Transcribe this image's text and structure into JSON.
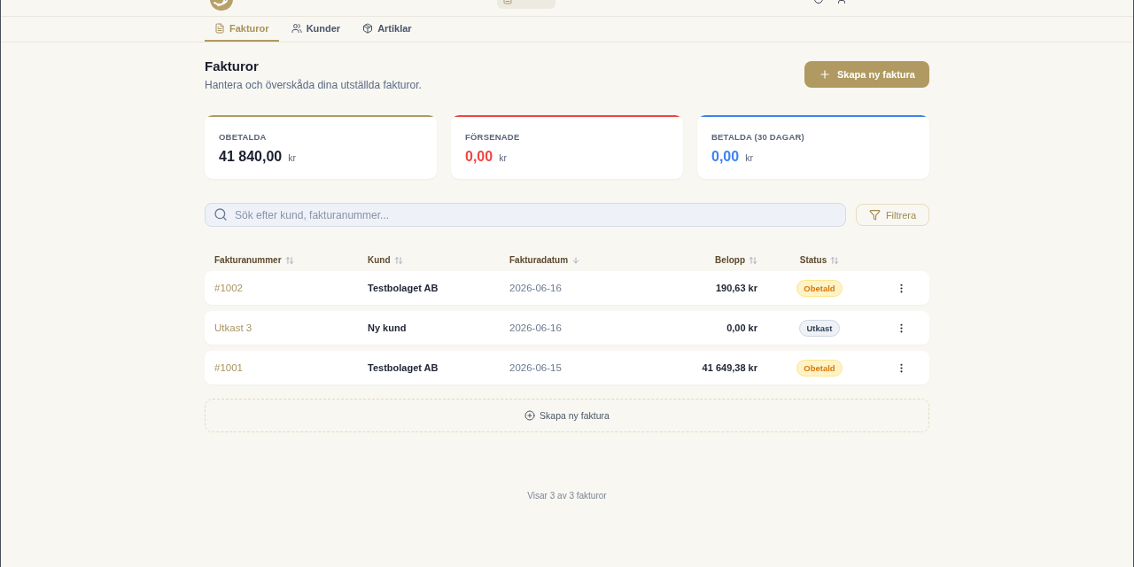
{
  "top_bar": {
    "nav": [
      {
        "selected": true
      }
    ]
  },
  "tabs": [
    {
      "label": "Fakturor",
      "kind": "document",
      "selected": true
    },
    {
      "label": "Kunder",
      "kind": "people",
      "selected": false
    },
    {
      "label": "Artiklar",
      "kind": "box",
      "selected": false
    }
  ],
  "header": {
    "title": "Fakturor",
    "subtitle": "Hantera och överskåda dina utställda fakturor.",
    "create_button": "Skapa ny faktura"
  },
  "summary_cards": [
    {
      "label": "OBETALDA",
      "amount": "41 840,00",
      "currency": "kr",
      "kind": "neutral",
      "color": "#b09a62"
    },
    {
      "label": "FÖRSENADE",
      "amount": "0,00",
      "currency": "kr",
      "kind": "accent",
      "color": "#ef4444"
    },
    {
      "label": "BETALDA (30 DAGAR)",
      "amount": "0,00",
      "currency": "kr",
      "kind": "accent",
      "color": "#3b82f6"
    }
  ],
  "search": {
    "placeholder": "Sök efter kund, fakturanummer..."
  },
  "filter_button": "Filtrera",
  "table": {
    "columns": [
      {
        "label": "Fakturanummer",
        "sorted": false
      },
      {
        "label": "Kund",
        "sorted": false
      },
      {
        "label": "Fakturadatum",
        "sorted": true
      },
      {
        "label": "Belopp",
        "sorted": false
      },
      {
        "label": "Status",
        "sorted": false
      }
    ],
    "rows": [
      {
        "number": "#1002",
        "customer": "Testbolaget AB",
        "date": "2026-06-16",
        "amount": "190,63 kr",
        "status": {
          "label": "Obetald",
          "kind": "unpaid"
        }
      },
      {
        "number": "Utkast 3",
        "customer": "Ny kund",
        "date": "2026-06-16",
        "amount": "0,00 kr",
        "status": {
          "label": "Utkast",
          "kind": "draft"
        }
      },
      {
        "number": "#1001",
        "customer": "Testbolaget AB",
        "date": "2026-06-15",
        "amount": "41 649,38 kr",
        "status": {
          "label": "Obetald",
          "kind": "unpaid"
        }
      }
    ]
  },
  "create_row": "Skapa ny faktura",
  "footer": "Visar 3 av 3 fakturor"
}
